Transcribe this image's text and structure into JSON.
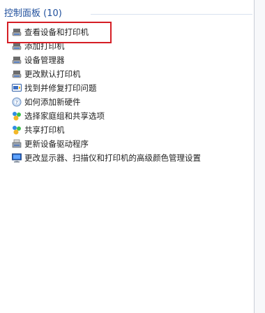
{
  "group": {
    "title": "控制面板 (10)"
  },
  "items": [
    {
      "label": "查看设备和打印机",
      "icon": "printer-devices-icon"
    },
    {
      "label": "添加打印机",
      "icon": "printer-devices-icon"
    },
    {
      "label": "设备管理器",
      "icon": "printer-devices-icon"
    },
    {
      "label": "更改默认打印机",
      "icon": "printer-devices-icon"
    },
    {
      "label": "找到并修复打印问题",
      "icon": "troubleshoot-icon"
    },
    {
      "label": "如何添加新硬件",
      "icon": "help-icon"
    },
    {
      "label": "选择家庭组和共享选项",
      "icon": "homegroup-icon"
    },
    {
      "label": "共享打印机",
      "icon": "homegroup-icon"
    },
    {
      "label": "更新设备驱动程序",
      "icon": "device-driver-icon"
    },
    {
      "label": "更改显示器、扫描仪和打印机的高级颜色管理设置",
      "icon": "monitor-icon"
    }
  ],
  "annotation": {
    "highlight_color": "#d51e25",
    "highlighted_item": 0
  }
}
